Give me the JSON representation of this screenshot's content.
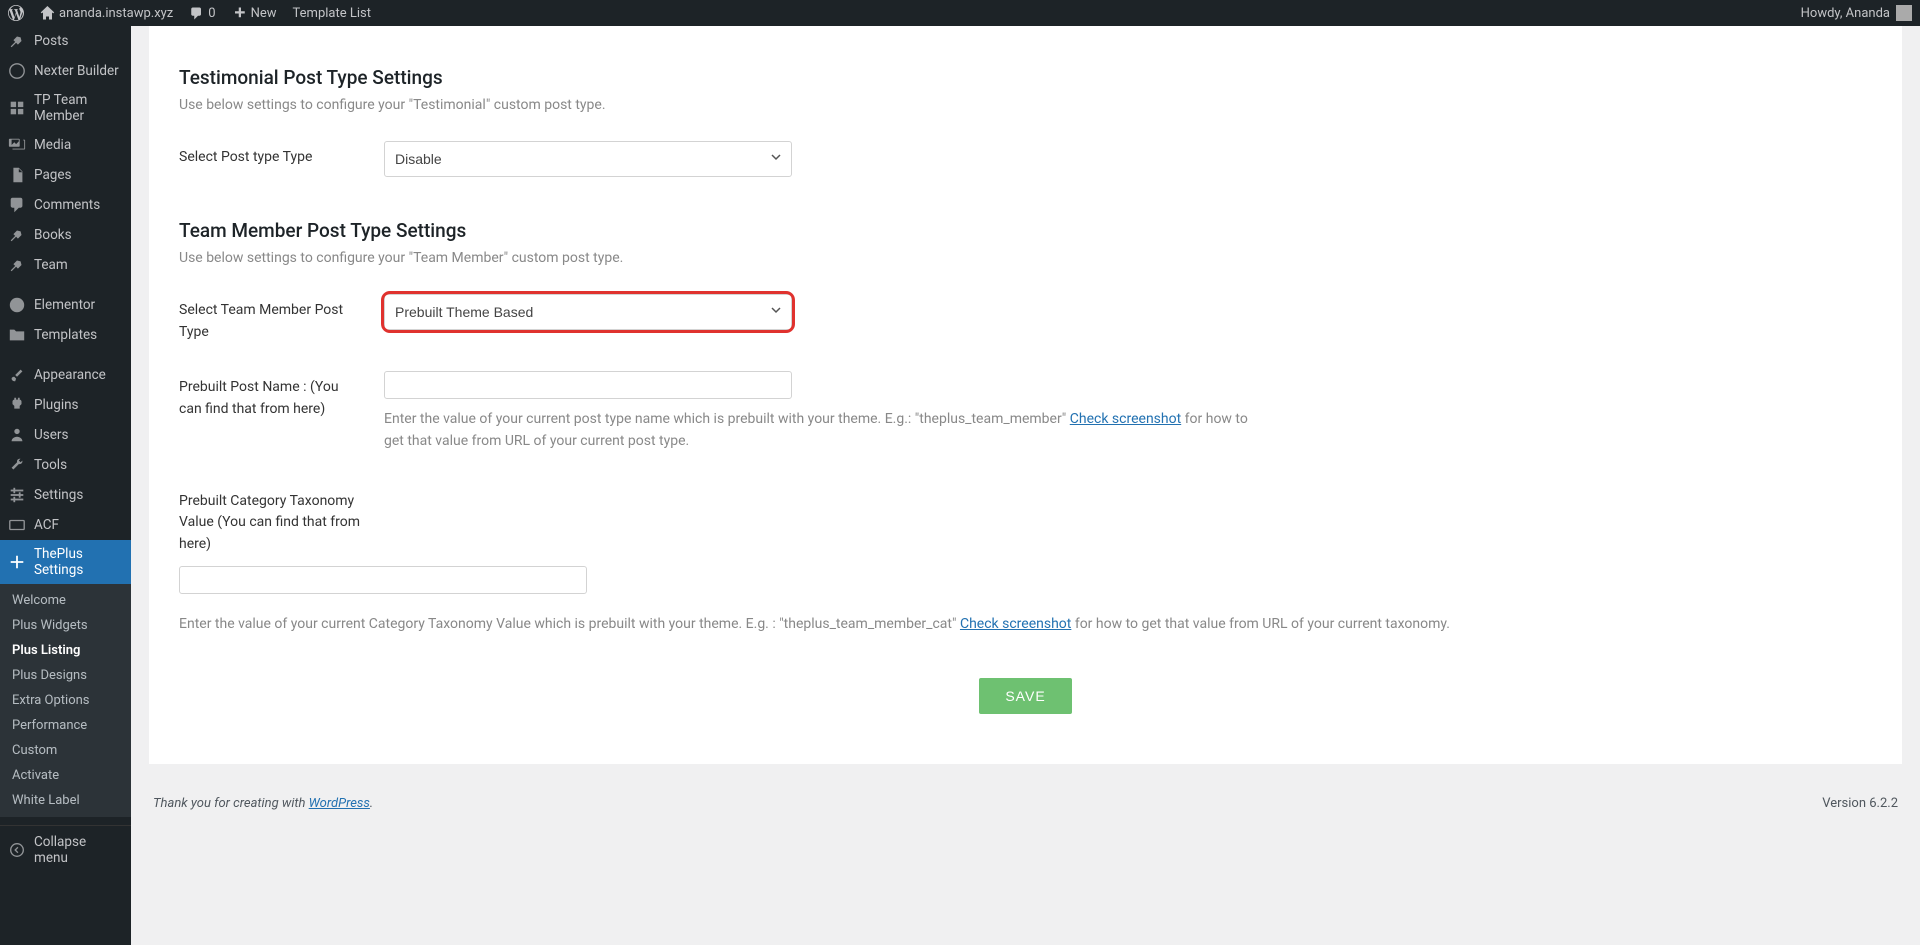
{
  "topbar": {
    "site_name": "ananda.instawp.xyz",
    "comments_count": "0",
    "new_label": "New",
    "template_list_label": "Template List",
    "greeting": "Howdy, Ananda"
  },
  "sidebar": {
    "items": [
      {
        "label": "Posts",
        "icon": "pin"
      },
      {
        "label": "Nexter Builder",
        "icon": "alert"
      },
      {
        "label": "TP Team Member",
        "icon": "grid"
      },
      {
        "label": "Media",
        "icon": "media"
      },
      {
        "label": "Pages",
        "icon": "page"
      },
      {
        "label": "Comments",
        "icon": "comment"
      },
      {
        "label": "Books",
        "icon": "pin"
      },
      {
        "label": "Team",
        "icon": "pin"
      },
      {
        "label": "Elementor",
        "icon": "elementor"
      },
      {
        "label": "Templates",
        "icon": "folder"
      },
      {
        "label": "Appearance",
        "icon": "brush"
      },
      {
        "label": "Plugins",
        "icon": "plug"
      },
      {
        "label": "Users",
        "icon": "user"
      },
      {
        "label": "Tools",
        "icon": "wrench"
      },
      {
        "label": "Settings",
        "icon": "settings"
      },
      {
        "label": "ACF",
        "icon": "acf"
      },
      {
        "label": "ThePlus Settings",
        "icon": "plus",
        "active": true
      }
    ],
    "submenu": [
      {
        "label": "Welcome"
      },
      {
        "label": "Plus Widgets"
      },
      {
        "label": "Plus Listing",
        "active": true
      },
      {
        "label": "Plus Designs"
      },
      {
        "label": "Extra Options"
      },
      {
        "label": "Performance"
      },
      {
        "label": "Custom"
      },
      {
        "label": "Activate"
      },
      {
        "label": "White Label"
      }
    ],
    "collapse_label": "Collapse menu"
  },
  "content": {
    "testimonial": {
      "title": "Testimonial Post Type Settings",
      "desc": "Use below settings to configure your \"Testimonial\" custom post type.",
      "select_label": "Select Post type Type",
      "select_value": "Disable"
    },
    "team": {
      "title": "Team Member Post Type Settings",
      "desc": "Use below settings to configure your \"Team Member\" custom post type.",
      "select_label": "Select Team Member Post Type",
      "select_value": "Prebuilt Theme Based",
      "name_label": "Prebuilt Post Name : (You can find that from here)",
      "name_help_before": "Enter the value of your current post type name which is prebuilt with your theme. E.g.: \"theplus_team_member\" ",
      "name_help_link": "Check screenshot",
      "name_help_after": " for how to get that value from URL of your current post type.",
      "tax_label": "Prebuilt Category Taxonomy Value (You can find that from here)",
      "tax_help_before": "Enter the value of your current Category Taxonomy Value which is prebuilt with your theme. E.g. : \"theplus_team_member_cat\" ",
      "tax_help_link": "Check screenshot",
      "tax_help_after": " for how to get that value from URL of your current taxonomy."
    },
    "save_label": "SAVE"
  },
  "footer": {
    "thank_text": "Thank you for creating with ",
    "wp_link": "WordPress",
    "period": ".",
    "version": "Version 6.2.2"
  }
}
